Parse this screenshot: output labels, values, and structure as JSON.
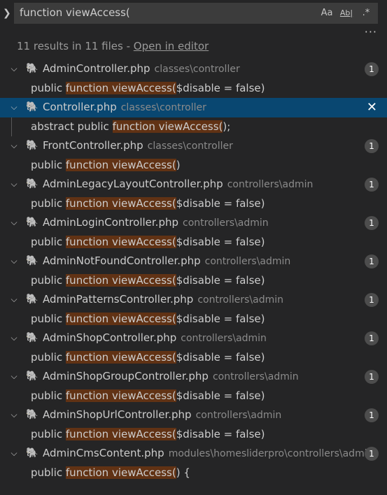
{
  "search": {
    "query": "function viewAccess(",
    "opt_case": "Aa",
    "opt_word": "Ab|",
    "opt_regex": ".*",
    "more": "···"
  },
  "summary": {
    "text": "11 results in 11 files - ",
    "link": "Open in editor"
  },
  "results": [
    {
      "file": "AdminController.php",
      "path": "classes\\controller",
      "count": "1",
      "active": false,
      "match": {
        "pre": "public ",
        "hl": "function viewAccess(",
        "post": "$disable = false)"
      }
    },
    {
      "file": "Controller.php",
      "path": "classes\\controller",
      "count": "1",
      "active": true,
      "match": {
        "pre": "abstract public ",
        "hl": "function viewAccess(",
        "post": ");"
      }
    },
    {
      "file": "FrontController.php",
      "path": "classes\\controller",
      "count": "1",
      "active": false,
      "match": {
        "pre": "public ",
        "hl": "function viewAccess(",
        "post": ")"
      }
    },
    {
      "file": "AdminLegacyLayoutController.php",
      "path": "controllers\\admin",
      "count": "1",
      "active": false,
      "match": {
        "pre": "public ",
        "hl": "function viewAccess(",
        "post": "$disable = false)"
      }
    },
    {
      "file": "AdminLoginController.php",
      "path": "controllers\\admin",
      "count": "1",
      "active": false,
      "match": {
        "pre": "public ",
        "hl": "function viewAccess(",
        "post": "$disable = false)"
      }
    },
    {
      "file": "AdminNotFoundController.php",
      "path": "controllers\\admin",
      "count": "1",
      "active": false,
      "match": {
        "pre": "public ",
        "hl": "function viewAccess(",
        "post": "$disable = false)"
      }
    },
    {
      "file": "AdminPatternsController.php",
      "path": "controllers\\admin",
      "count": "1",
      "active": false,
      "match": {
        "pre": "public ",
        "hl": "function viewAccess(",
        "post": "$disable = false)"
      }
    },
    {
      "file": "AdminShopController.php",
      "path": "controllers\\admin",
      "count": "1",
      "active": false,
      "match": {
        "pre": "public ",
        "hl": "function viewAccess(",
        "post": "$disable = false)"
      }
    },
    {
      "file": "AdminShopGroupController.php",
      "path": "controllers\\admin",
      "count": "1",
      "active": false,
      "match": {
        "pre": "public ",
        "hl": "function viewAccess(",
        "post": "$disable = false)"
      }
    },
    {
      "file": "AdminShopUrlController.php",
      "path": "controllers\\admin",
      "count": "1",
      "active": false,
      "match": {
        "pre": "public ",
        "hl": "function viewAccess(",
        "post": "$disable = false)"
      }
    },
    {
      "file": "AdminCmsContent.php",
      "path": "modules\\homesliderpro\\controllers\\admin",
      "count": "1",
      "active": false,
      "match": {
        "pre": "public ",
        "hl": "function viewAccess(",
        "post": ") {"
      }
    }
  ],
  "colors": {
    "background": "#252526",
    "active_row": "#094771",
    "match_highlight": "#613214",
    "php_icon": "#a074c4"
  }
}
